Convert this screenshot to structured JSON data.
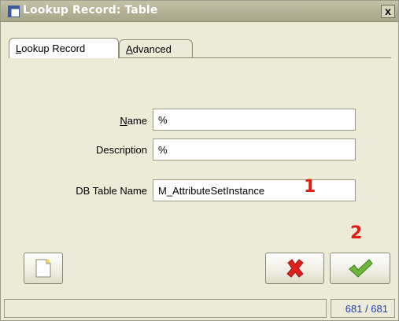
{
  "window": {
    "title": "Lookup Record: Table",
    "close_label": "x"
  },
  "tabs": [
    {
      "label_first": "L",
      "label_rest": "ookup Record",
      "active": true
    },
    {
      "label_first": "A",
      "label_rest": "dvanced",
      "active": false
    }
  ],
  "form": {
    "name": {
      "label_first": "N",
      "label_rest": "ame",
      "value": "%"
    },
    "description": {
      "label": "Description",
      "value": "%"
    },
    "db_table_name": {
      "label": "DB Table Name",
      "value": "M_AttributeSetInstance"
    }
  },
  "annotations": {
    "marker_1": "1",
    "marker_2": "2"
  },
  "buttons": {
    "new_record_icon": "new-document-icon",
    "cancel_icon": "red-x-icon",
    "ok_icon": "green-check-icon"
  },
  "statusbar": {
    "message": "",
    "record_count": "681 / 681"
  },
  "colors": {
    "marker": "#e8190f",
    "title_text": "#ffffff",
    "record_count_text": "#1f3fb0"
  }
}
